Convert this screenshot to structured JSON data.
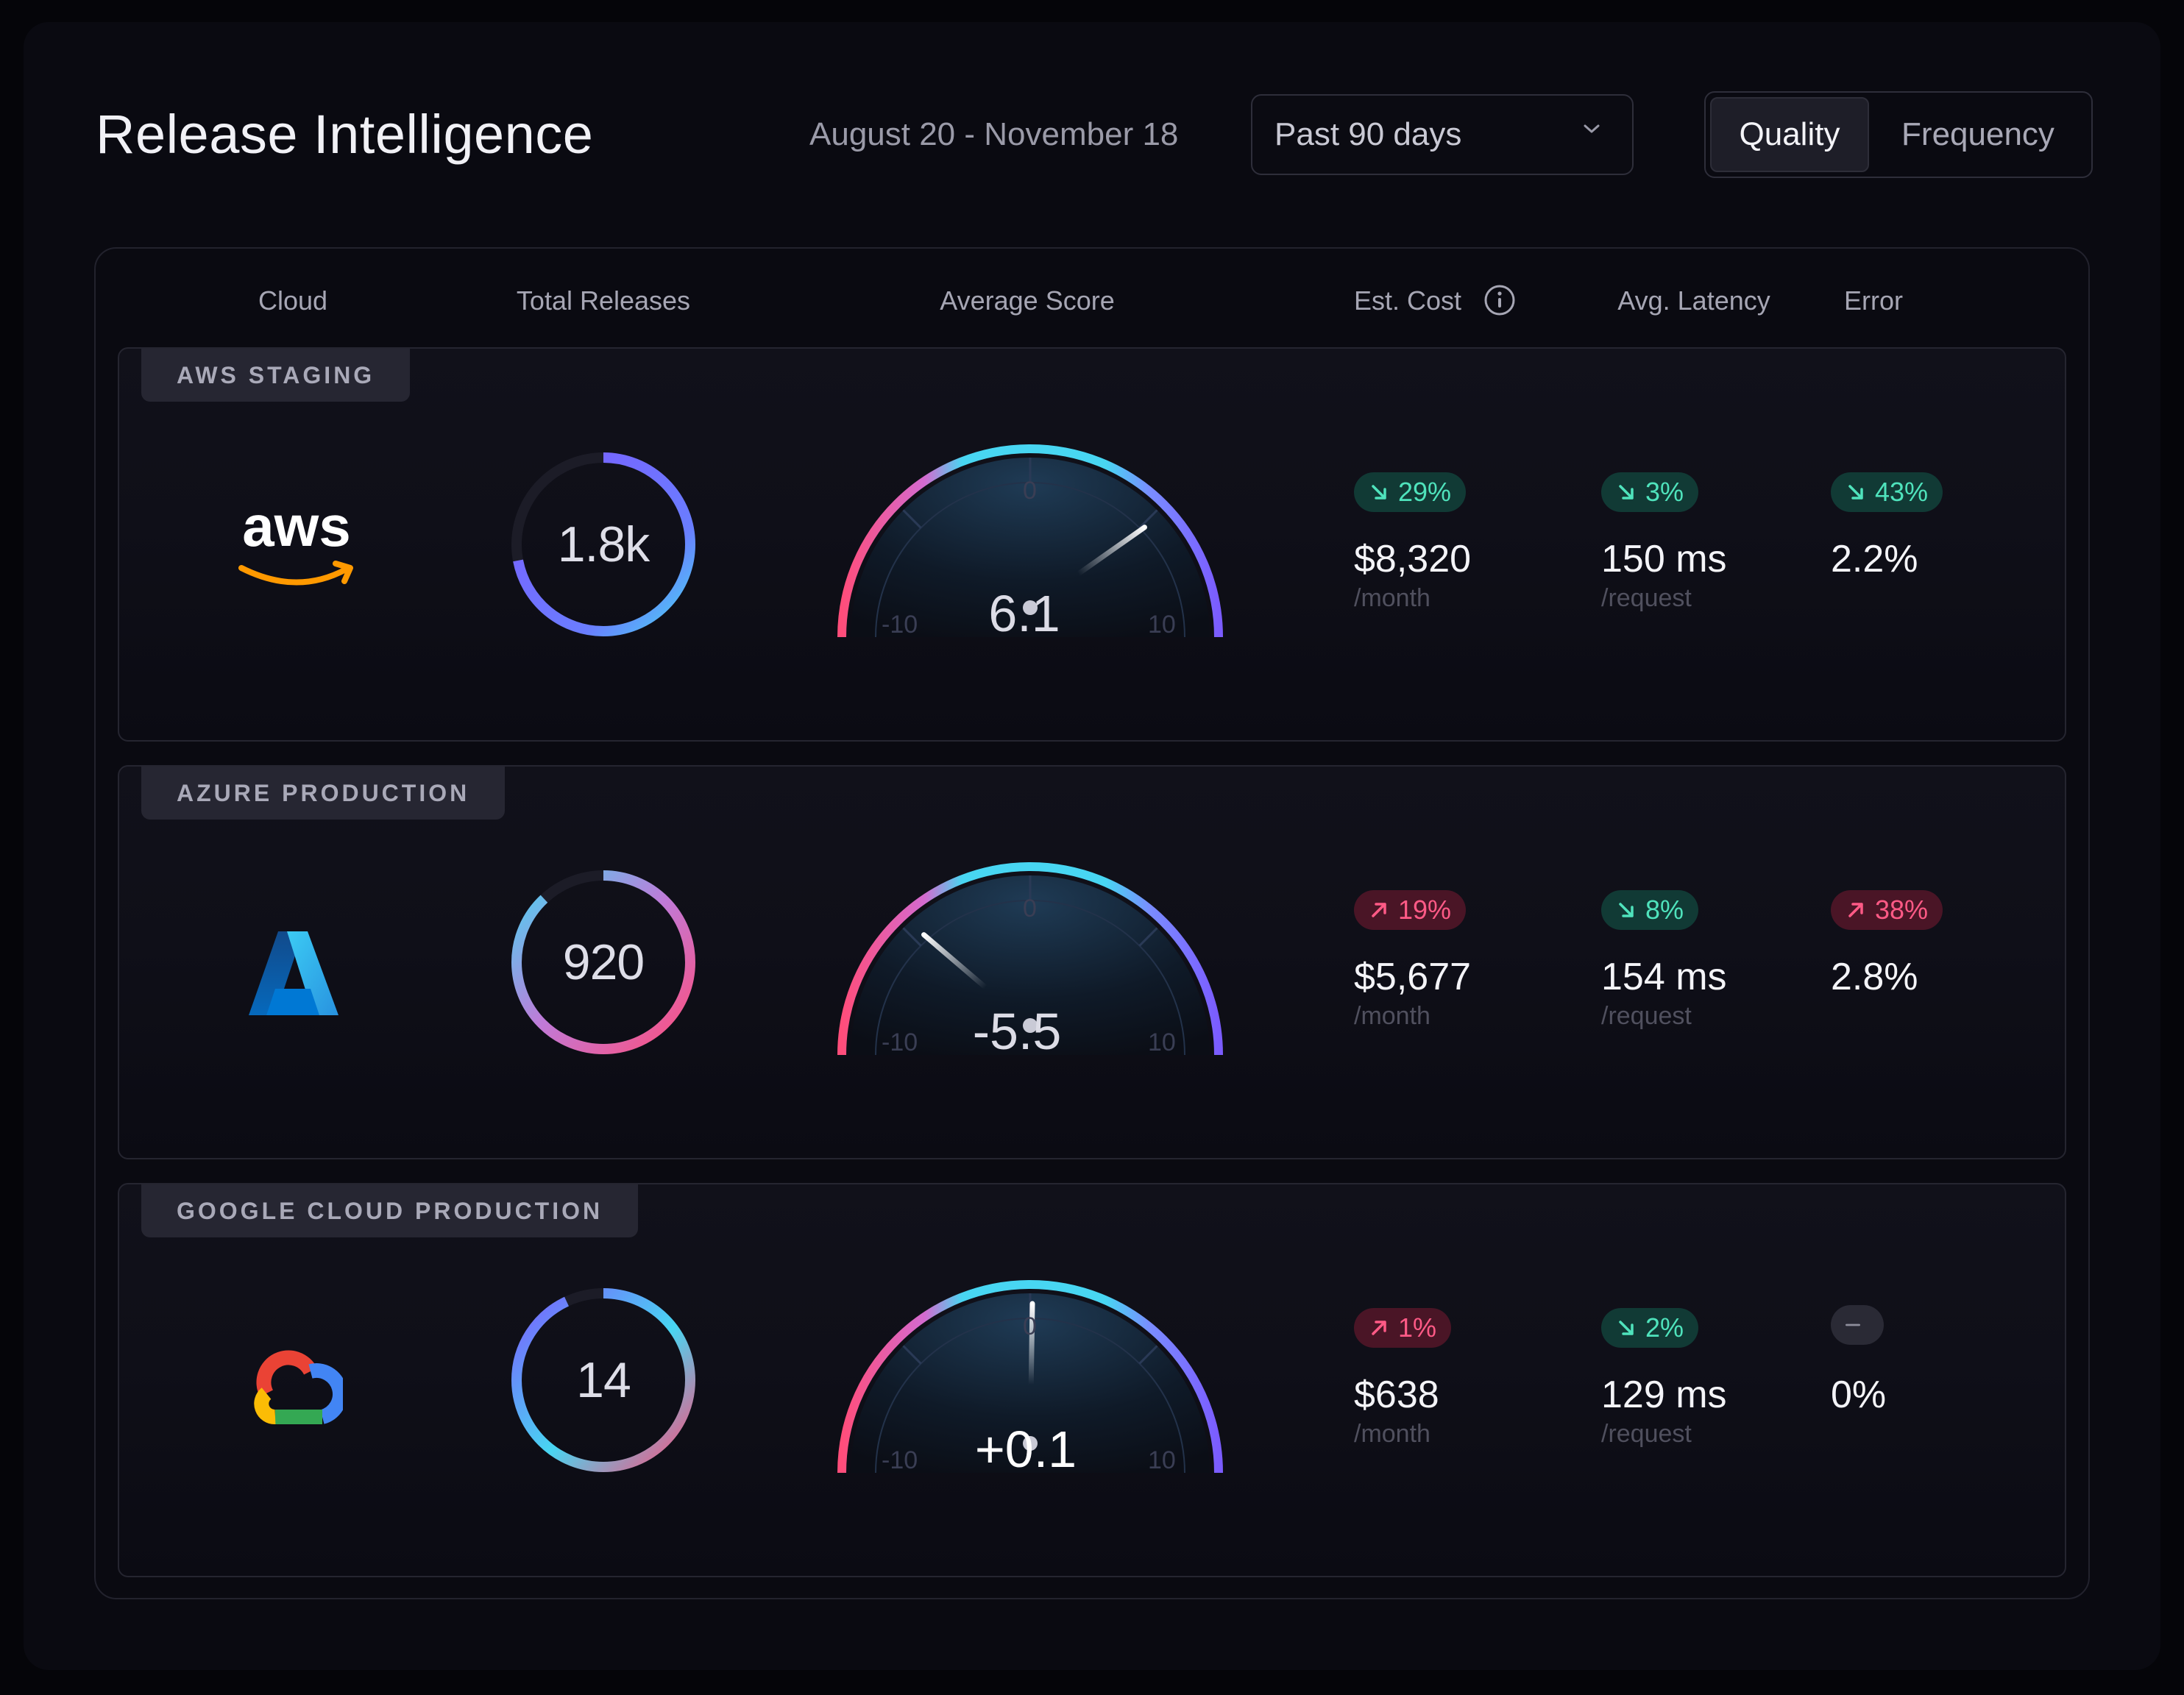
{
  "header": {
    "title": "Release Intelligence",
    "date_range": "August 20 - November 18",
    "period_select": "Past 90 days",
    "toggle": [
      "Quality",
      "Frequency"
    ]
  },
  "columns": {
    "cloud": "Cloud",
    "total_releases": "Total Releases",
    "average_score": "Average Score",
    "est_cost": "Est. Cost",
    "avg_latency": "Avg. Latency",
    "error": "Error"
  },
  "rows": [
    {
      "tag": "AWS STAGING",
      "logo": "aws-logo",
      "logo_text": "aws",
      "releases": "1.8k",
      "releases_fraction": 0.72,
      "score": "6.1",
      "score_value": 6.1,
      "score_min": "-10",
      "score_mid": "0",
      "score_max": "10",
      "cost_change": "29%",
      "cost_dir": "down",
      "cost": "$8,320",
      "cost_unit": "/month",
      "latency_change": "3%",
      "latency_dir": "down",
      "latency": "150 ms",
      "latency_unit": "/request",
      "error_change": "43%",
      "error_dir": "down",
      "error": "2.2%"
    },
    {
      "tag": "AZURE PRODUCTION",
      "logo": "azure-logo",
      "releases": "920",
      "releases_fraction": 0.88,
      "score": "-5.5",
      "score_value": -5.5,
      "score_min": "-10",
      "score_mid": "0",
      "score_max": "10",
      "cost_change": "19%",
      "cost_dir": "up",
      "cost": "$5,677",
      "cost_unit": "/month",
      "latency_change": "8%",
      "latency_dir": "down",
      "latency": "154 ms",
      "latency_unit": "/request",
      "error_change": "38%",
      "error_dir": "up",
      "error": "2.8%"
    },
    {
      "tag": "GOOGLE CLOUD PRODUCTION",
      "logo": "google-cloud-logo",
      "releases": "14",
      "releases_fraction": 0.93,
      "score": "+0.1",
      "score_value": 0.1,
      "score_min": "-10",
      "score_mid": "0",
      "score_max": "10",
      "cost_change": "1%",
      "cost_dir": "up",
      "cost": "$638",
      "cost_unit": "/month",
      "latency_change": "2%",
      "latency_dir": "down",
      "latency": "129 ms",
      "latency_unit": "/request",
      "error_change": "",
      "error_dir": "neutral",
      "error": "0%"
    }
  ],
  "colors": {
    "accent_cyan": "#48d6f2",
    "accent_purple": "#7b5cff",
    "accent_pink": "#ff4d7a",
    "good": "#4fe3bc",
    "bad": "#ff5a86"
  }
}
